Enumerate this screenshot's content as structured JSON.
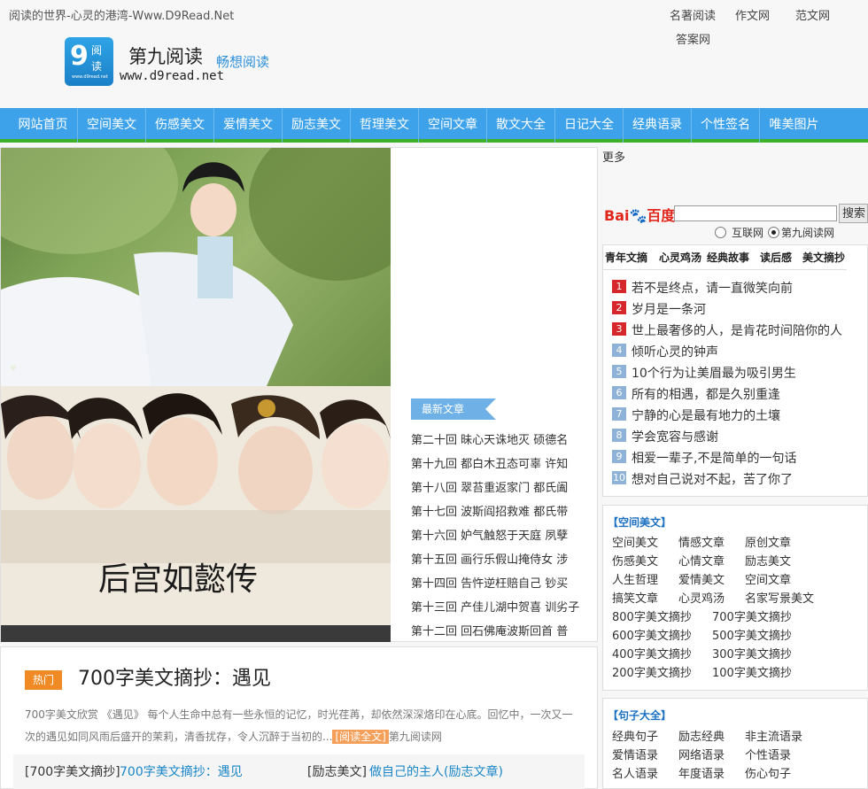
{
  "header": {
    "slogan": "阅读的世界-心灵的港湾-Www.D9Read.Net",
    "links": [
      "名著阅读",
      "作文网",
      "范文网",
      "答案网"
    ],
    "logo_main": "9",
    "logo_cn_1": "阅",
    "logo_cn_2": "读",
    "logo_small": "www.d9read.net",
    "site_name": "第九阅读",
    "site_tagline": "畅想阅读",
    "site_url": "www.d9read.net"
  },
  "nav": [
    "网站首页",
    "空间美文",
    "伤感美文",
    "爱情美文",
    "励志美文",
    "哲理美文",
    "空间文章",
    "散文大全",
    "日记大全",
    "经典语录",
    "个性签名",
    "唯美图片"
  ],
  "slider": {
    "poster_title": "后宫如懿传"
  },
  "latest": {
    "tag": "最新文章",
    "items": [
      "第二十回 昧心天诛地灭 硕德名",
      "第十九回 都白木丑态可辜 许知",
      "第十八回 翠苔重返家门 都氏阖",
      "第十七回 波斯阎招救难 都氏带",
      "第十六回 妒气触怒于天庭 夙孽",
      "第十五回 画行乐假山掩侍女 涉",
      "第十四回 告忤逆枉赔自己 钞买",
      "第十三回 产佳儿湖中贺喜 训劣子",
      "第十二回 回石佛庵波斯回首 普"
    ]
  },
  "hot": {
    "badge": "热门",
    "title": "700字美文摘抄：遇见",
    "summary": "700字美文欣赏 《遇见》 每个人生命中总有一些永恒的记忆，时光荏苒，却依然深深烙印在心底。回忆中，一次又一次的遇见如同风雨后盛开的茉莉，清香扰存，令人沉醉于当初的...",
    "read_more": "[阅读全文]",
    "source": "第九阅读网",
    "list": [
      {
        "cat": "[700字美文摘抄]",
        "title": "700字美文摘抄：遇见"
      },
      {
        "cat": "[励志美文]",
        "title": "做自己的主人(励志文章)"
      }
    ]
  },
  "sidebar": {
    "more": "更多",
    "search": {
      "logo_a": "Bai",
      "logo_b": "度",
      "logo_c": "百度",
      "button": "搜索",
      "value": "",
      "options": [
        "互联网",
        "第九阅读网"
      ],
      "selected": "第九阅读网"
    },
    "rank_tabs": [
      "青年文摘",
      "心灵鸡汤",
      "经典故事",
      "读后感",
      "美文摘抄"
    ],
    "rank_items": [
      "若不是终点，请一直微笑向前",
      "岁月是一条河",
      "世上最奢侈的人，是肯花时间陪你的人",
      "倾听心灵的钟声",
      "10个行为让美眉最为吸引男生",
      "所有的相遇，都是久别重逢",
      "宁静的心是最有地力的土壤",
      "学会宽容与感谢",
      "相爱一辈子,不是简单的一句话",
      "想对自己说对不起，苦了你了"
    ],
    "rank_numbers": [
      "1",
      "2",
      "3",
      "4",
      "5",
      "6",
      "7",
      "8",
      "9",
      "10"
    ],
    "rank_colors": {
      "top": "#d6282c",
      "rest": "#8fb3d8"
    },
    "categories": {
      "title": "【空间美文】",
      "rows": [
        [
          "空间美文",
          "情感文章",
          "原创文章"
        ],
        [
          "伤感美文",
          "心情文章",
          "励志美文"
        ],
        [
          "人生哲理",
          "爱情美文",
          "空间文章"
        ],
        [
          "搞笑文章",
          "心灵鸡汤",
          "名家写景美文"
        ],
        [
          "800字美文摘抄",
          "700字美文摘抄"
        ],
        [
          "600字美文摘抄",
          "500字美文摘抄"
        ],
        [
          "400字美文摘抄",
          "300字美文摘抄"
        ],
        [
          "200字美文摘抄",
          "100字美文摘抄"
        ]
      ]
    },
    "quotes": {
      "title": "【句子大全】",
      "rows": [
        [
          "经典句子",
          "励志经典",
          "非主流语录"
        ],
        [
          "爱情语录",
          "网络语录",
          "个性语录"
        ],
        [
          "名人语录",
          "年度语录",
          "伤心句子"
        ]
      ]
    }
  },
  "colors": {
    "nav_bg": "#3da2ea",
    "nav_border": "#3fb02a",
    "accent_orange": "#f08a24",
    "link_blue": "#1a86c8"
  }
}
